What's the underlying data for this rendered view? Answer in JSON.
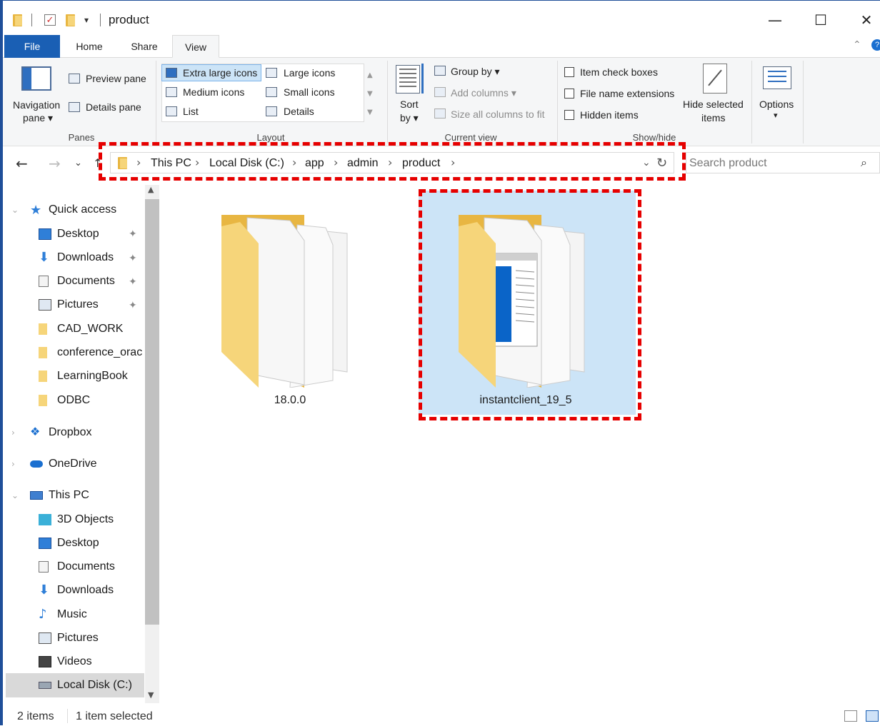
{
  "window": {
    "title": "product",
    "controls": {
      "minimize": "—",
      "maximize": "☐",
      "close": "✕"
    }
  },
  "ribbon_tabs": [
    {
      "label": "File"
    },
    {
      "label": "Home"
    },
    {
      "label": "Share"
    },
    {
      "label": "View"
    }
  ],
  "ribbon": {
    "panes": {
      "navigation_pane_line1": "Navigation",
      "navigation_pane_line2": "pane",
      "preview_pane": "Preview pane",
      "details_pane": "Details pane",
      "group_label": "Panes"
    },
    "layout": {
      "extra_large_icons": "Extra large icons",
      "large_icons": "Large icons",
      "medium_icons": "Medium icons",
      "small_icons": "Small icons",
      "list": "List",
      "details": "Details",
      "group_label": "Layout",
      "selected": "Extra large icons"
    },
    "current_view": {
      "sort_line1": "Sort",
      "sort_line2": "by",
      "group_by": "Group by",
      "add_columns": "Add columns",
      "size_all_columns": "Size all columns to fit",
      "group_label": "Current view"
    },
    "show_hide": {
      "item_check_boxes": "Item check boxes",
      "file_name_extensions": "File name extensions",
      "hidden_items": "Hidden items",
      "hide_selected_line1": "Hide selected",
      "hide_selected_line2": "items",
      "group_label": "Show/hide"
    },
    "options": "Options"
  },
  "address": {
    "crumbs": [
      "This PC",
      "Local Disk (C:)",
      "app",
      "admin",
      "product"
    ]
  },
  "search": {
    "placeholder": "Search product"
  },
  "nav_pane": {
    "quick_access": "Quick access",
    "quick_items": [
      "Desktop",
      "Downloads",
      "Documents",
      "Pictures",
      "CAD_WORK",
      "conference_orac",
      "LearningBook",
      "ODBC"
    ],
    "dropbox": "Dropbox",
    "onedrive": "OneDrive",
    "this_pc": "This PC",
    "pc_items": [
      "3D Objects",
      "Desktop",
      "Documents",
      "Downloads",
      "Music",
      "Pictures",
      "Videos",
      "Local Disk (C:)"
    ]
  },
  "content": {
    "items": [
      {
        "name": "18.0.0",
        "selected": false
      },
      {
        "name": "instantclient_19_5",
        "selected": true
      }
    ]
  },
  "status": {
    "count": "2 items",
    "selection": "1 item selected"
  },
  "colors": {
    "accent": "#1a5fb4",
    "highlight": "#e60000",
    "selection": "#cce4f7",
    "folder": "#f6d57a"
  }
}
